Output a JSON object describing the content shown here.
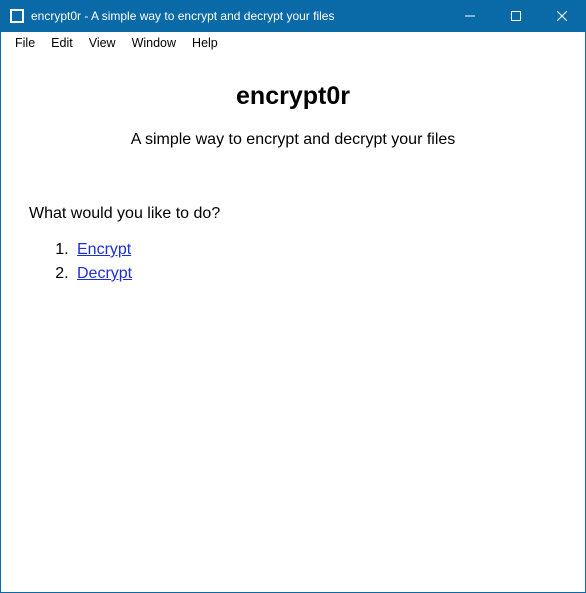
{
  "window": {
    "title": "encrypt0r - A simple way to encrypt and decrypt your files"
  },
  "menu": {
    "items": [
      "File",
      "Edit",
      "View",
      "Window",
      "Help"
    ]
  },
  "main": {
    "title": "encrypt0r",
    "subtitle": "A simple way to encrypt and decrypt your files",
    "prompt": "What would you like to do?",
    "options": [
      "Encrypt",
      "Decrypt"
    ]
  }
}
